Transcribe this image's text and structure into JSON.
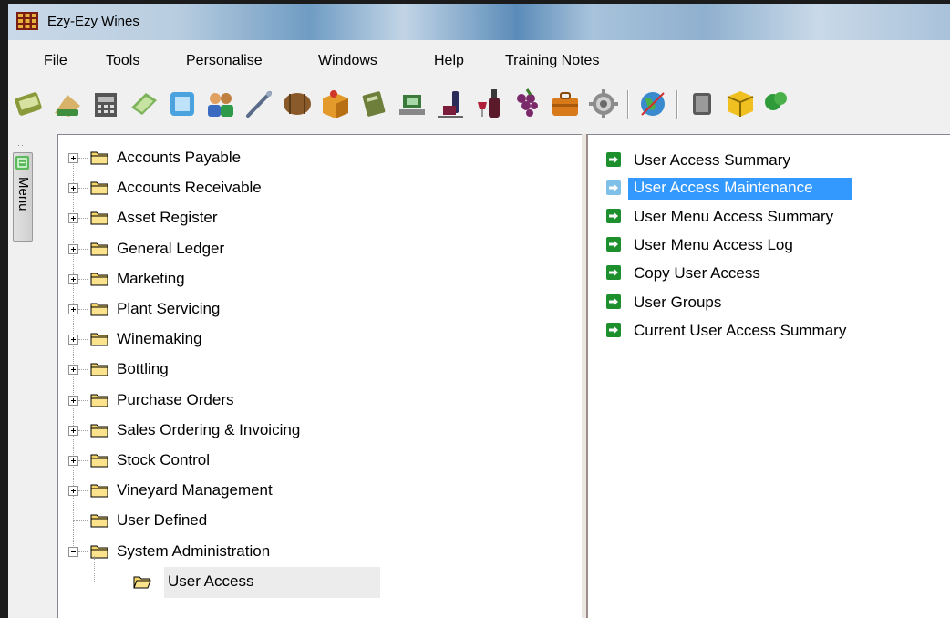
{
  "window": {
    "title": "Ezy-Ezy Wines"
  },
  "menu": [
    "File",
    "Tools",
    "Personalise",
    "Windows",
    "Help",
    "Training Notes"
  ],
  "toolbar": {
    "icons": [
      "accounts-payable-icon",
      "accounts-receivable-icon",
      "asset-register-icon",
      "general-ledger-icon",
      "marketing-icon",
      "plant-servicing-icon",
      "winemaking-tools-icon",
      "barrel-icon",
      "bottling-icon",
      "purchase-orders-icon",
      "sales-icon",
      "stock-control-icon",
      "wine-icon",
      "grapes-icon",
      "briefcase-icon",
      "gear-icon",
      "globe-icon",
      "database-icon",
      "box-icon",
      "vineyard-icon"
    ]
  },
  "side_menu": {
    "tab_label": "Menu"
  },
  "tree": {
    "nodes": [
      {
        "label": "Accounts Payable",
        "expander": "plus"
      },
      {
        "label": "Accounts Receivable",
        "expander": "plus"
      },
      {
        "label": "Asset Register",
        "expander": "plus"
      },
      {
        "label": "General Ledger",
        "expander": "plus"
      },
      {
        "label": "Marketing",
        "expander": "plus"
      },
      {
        "label": "Plant Servicing",
        "expander": "plus"
      },
      {
        "label": "Winemaking",
        "expander": "plus"
      },
      {
        "label": "Bottling",
        "expander": "plus"
      },
      {
        "label": "Purchase Orders",
        "expander": "plus"
      },
      {
        "label": "Sales Ordering & Invoicing",
        "expander": "plus"
      },
      {
        "label": "Stock Control",
        "expander": "plus"
      },
      {
        "label": "Vineyard Management",
        "expander": "plus"
      },
      {
        "label": "User Defined",
        "expander": "none"
      },
      {
        "label": "System Administration",
        "expander": "minus"
      }
    ],
    "child": {
      "label": "User Access",
      "selected": true
    }
  },
  "list": {
    "items": [
      {
        "label": "User Access Summary",
        "selected": false
      },
      {
        "label": "User Access Maintenance",
        "selected": true
      },
      {
        "label": "User Menu Access Summary",
        "selected": false
      },
      {
        "label": "User Menu Access Log",
        "selected": false
      },
      {
        "label": "Copy User Access",
        "selected": false
      },
      {
        "label": "User Groups",
        "selected": false
      },
      {
        "label": "Current User Access Summary",
        "selected": false
      }
    ]
  },
  "colors": {
    "selection": "#3399ff",
    "tree_selection": "#ececec",
    "folder": "#f5d46a",
    "arrow_icon": "#1d8f2c"
  }
}
